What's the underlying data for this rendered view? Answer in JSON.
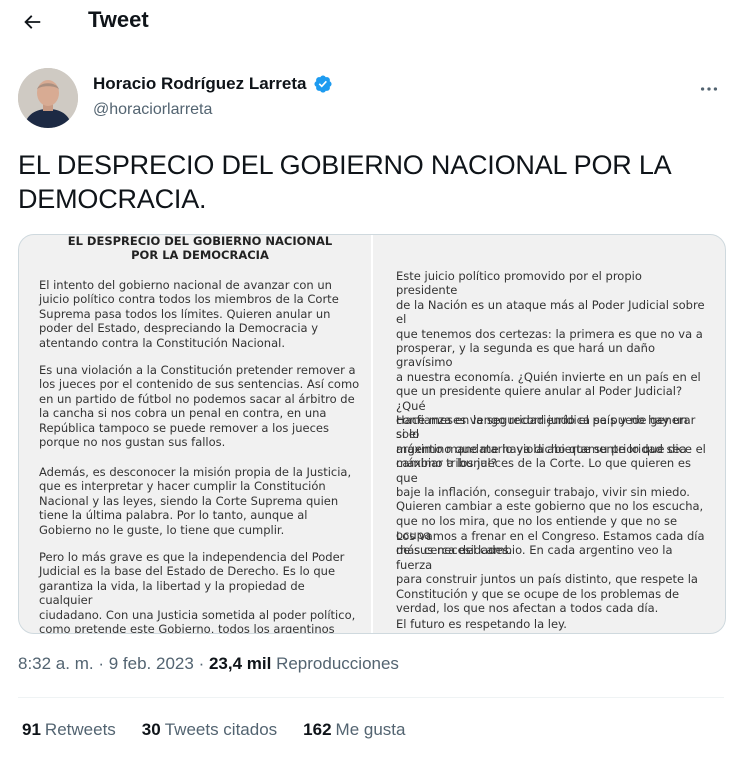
{
  "header": {
    "title": "Tweet"
  },
  "author": {
    "display_name": "Horacio Rodríguez Larreta",
    "handle": "@horaciorlarreta"
  },
  "tweet": {
    "text": "EL DESPRECIO DEL GOBIERNO NACIONAL POR LA DEMOCRACIA."
  },
  "media_doc": {
    "title_line1": "EL DESPRECIO DEL GOBIERNO NACIONAL",
    "title_line2": "POR LA DEMOCRACIA",
    "left_paragraphs": [
      "El intento del gobierno nacional de avanzar con un\njuicio político contra todos los miembros de la Corte\nSuprema pasa todos los límites. Quieren anular un\npoder del Estado, despreciando la Democracia y\natentando contra la Constitución Nacional.",
      "Es una violación a la Constitución pretender remover a\nlos jueces por el contenido de sus sentencias. Así como\nen un partido de fútbol no podemos sacar al árbitro de\nla cancha si nos cobra un penal en contra, en una\nRepública tampoco se puede remover a los jueces\nporque no nos gustan sus fallos.",
      "Además, es desconocer la misión propia de la Justicia,\nque es interpretar y hacer cumplir la Constitución\nNacional y las leyes, siendo la Corte Suprema quien\ntiene la última palabra. Por lo tanto, aunque al\nGobierno no le guste, lo tiene que cumplir.",
      "Pero lo más grave es que la independencia del Poder\nJudicial es la base del Estado de Derecho. Es lo que\ngarantiza la vida, la libertad y la propiedad de cualquier\nciudadano. Con una Justicia sometida al poder político,\ncomo pretende este Gobierno, todos los argentinos\nquedamos desamparados."
    ],
    "right_paragraphs": [
      "Este juicio político promovido por el propio presidente\nde la Nación es un ataque más al Poder Judicial sobre el\nque tenemos dos certezas: la primera es que no va a\nprosperar, y la segunda es que hará un daño gravísimo\na nuestra economía. ¿Quién invierte en un país en el\nque un presidente quiere anular al Poder Judicial? ¿Qué\nconfianza en la seguridad jurídica se puede generar si el\nmáximo mandatario viola abiertamente lo que dice el\nmáximo tribunal?",
      "Hace meses vengo recorriendo el país y no hay un solo\nargentino que me haya dicho que su prioridad sea\ncambiar a los jueces de la Corte. Lo que quieren es que\nbaje la inflación, conseguir trabajo, vivir sin miedo.\nQuieren cambiar a este gobierno que no los escucha,\nque no los mira, que no los entiende y que no se ocupa\nde sus necesidades.",
      "Los vamos a frenar en el Congreso. Estamos cada día\nmás cerca del cambio. En cada argentino veo la fuerza\npara construir juntos un país distinto, que respete la\nConstitución y que se ocupe de los problemas de\nverdad, los que nos afectan a todos cada día.",
      "El futuro es respetando la ley."
    ]
  },
  "meta": {
    "time": "8:32 a. m.",
    "separator": "·",
    "date": "9 feb. 2023",
    "views_count": "23,4 mil",
    "views_label": "Reproducciones"
  },
  "stats": [
    {
      "count": "91",
      "label": "Retweets"
    },
    {
      "count": "30",
      "label": "Tweets citados"
    },
    {
      "count": "162",
      "label": "Me gusta"
    }
  ],
  "colors": {
    "text_primary": "#0f1419",
    "text_secondary": "#536471",
    "verified_badge": "#1d9bf0",
    "border": "#cfd9de",
    "doc_background": "#f1f1f1"
  },
  "icons": {
    "back": "arrow-left-icon",
    "verified": "verified-badge-icon",
    "more": "more-horizontal-icon"
  }
}
